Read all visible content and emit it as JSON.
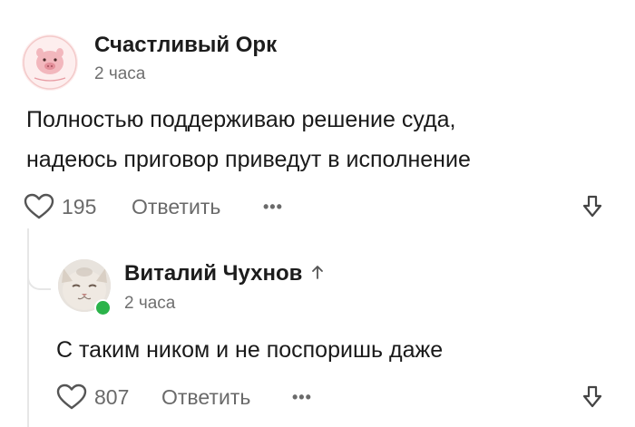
{
  "comment": {
    "author": "Счастливый Орк",
    "time": "2 часа",
    "text_lines": [
      "Полностью поддерживаю решение суда,",
      "надеюсь приговор приведут в исполнение"
    ],
    "likes": "195",
    "reply_label": "Ответить",
    "more_label": "•••"
  },
  "reply": {
    "author": "Виталий Чухнов",
    "reply_to_icon": "arrow-up-icon",
    "time": "2 часа",
    "text": "С таким ником и не поспоришь даже",
    "likes": "807",
    "reply_label": "Ответить",
    "more_label": "•••",
    "online": true
  },
  "icons": {
    "like": "heart-outline-icon",
    "downvote": "arrow-down-icon"
  },
  "colors": {
    "online": "#2bb34a",
    "muted": "#6a6a6a"
  }
}
